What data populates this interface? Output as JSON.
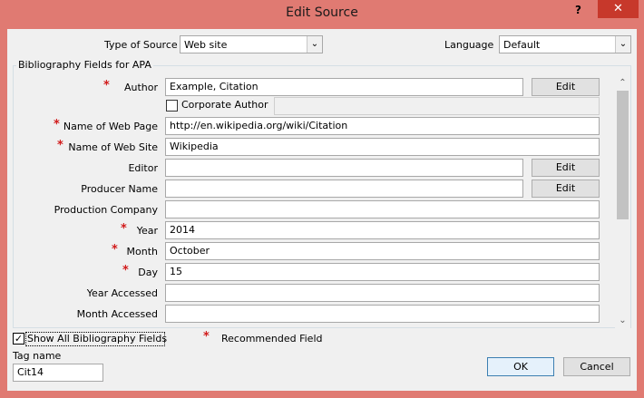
{
  "window": {
    "title": "Edit Source",
    "help_label": "?",
    "close_label": "✕"
  },
  "type_of_source": {
    "label": "Type of Source",
    "value": "Web site"
  },
  "language": {
    "label": "Language",
    "value": "Default"
  },
  "group": {
    "label": "Bibliography Fields for APA"
  },
  "fields": {
    "author": {
      "label": "Author",
      "value": "Example, Citation",
      "button": "Edit"
    },
    "corporate_author": {
      "label": "Corporate Author",
      "value": ""
    },
    "name_of_web_page": {
      "label": "Name of Web Page",
      "value": "http://en.wikipedia.org/wiki/Citation"
    },
    "name_of_web_site": {
      "label": "Name of Web Site",
      "value": "Wikipedia"
    },
    "editor": {
      "label": "Editor",
      "value": "",
      "button": "Edit"
    },
    "producer_name": {
      "label": "Producer Name",
      "value": "",
      "button": "Edit"
    },
    "production_company": {
      "label": "Production Company",
      "value": ""
    },
    "year": {
      "label": "Year",
      "value": "2014"
    },
    "month": {
      "label": "Month",
      "value": "October"
    },
    "day": {
      "label": "Day",
      "value": "15"
    },
    "year_accessed": {
      "label": "Year Accessed",
      "value": ""
    },
    "month_accessed": {
      "label": "Month Accessed",
      "value": ""
    }
  },
  "recommended_marker": "*",
  "show_all": {
    "label": "Show All Bibliography Fields",
    "checked": true
  },
  "legend": {
    "marker": "*",
    "text": "Recommended Field"
  },
  "tag_name": {
    "label": "Tag name",
    "value": "Cit14"
  },
  "buttons": {
    "ok": "OK",
    "cancel": "Cancel"
  },
  "colors": {
    "window_frame": "#e07a72",
    "close_button": "#c7382b",
    "required_star": "#d11a1a"
  }
}
